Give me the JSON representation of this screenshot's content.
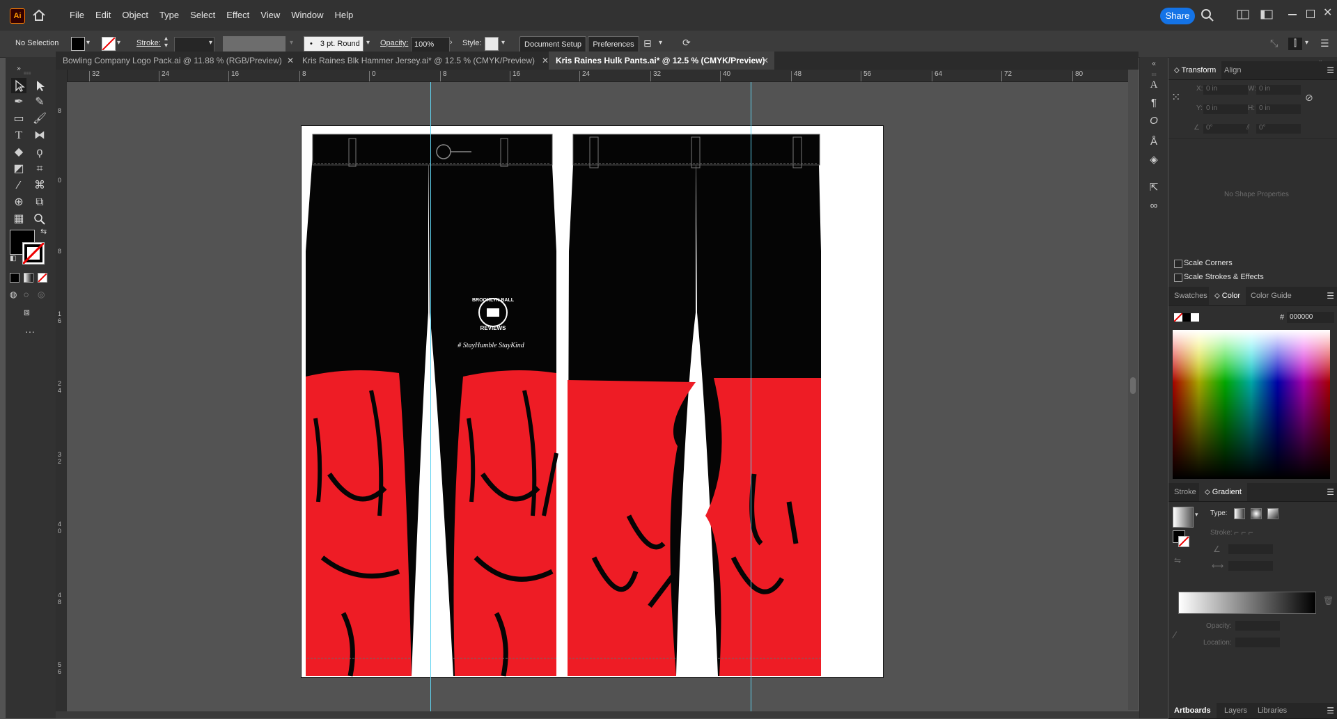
{
  "app": {
    "logo": "Ai",
    "share_label": "Share"
  },
  "menu": [
    "File",
    "Edit",
    "Object",
    "Type",
    "Select",
    "Effect",
    "View",
    "Window",
    "Help"
  ],
  "control_bar": {
    "selection": "No Selection",
    "stroke_label": "Stroke:",
    "brush": "3 pt. Round",
    "opacity_label": "Opacity:",
    "opacity_value": "100%",
    "style_label": "Style:",
    "document_setup": "Document Setup",
    "preferences": "Preferences"
  },
  "tabs": [
    {
      "label": "Bowling Company Logo Pack.ai @ 11.88 % (RGB/Preview)",
      "active": false
    },
    {
      "label": "Kris Raines Blk Hammer Jersey.ai* @ 12.5 % (CMYK/Preview)",
      "active": false
    },
    {
      "label": "Kris Raines Hulk Pants.ai* @ 12.5 % (CMYK/Preview)",
      "active": true
    }
  ],
  "ruler_h": [
    "32",
    "24",
    "16",
    "8",
    "0",
    "8",
    "16",
    "24",
    "32",
    "40",
    "48",
    "56",
    "64",
    "72",
    "80"
  ],
  "ruler_v": [
    "8",
    "0",
    "8",
    "1\n6",
    "2\n4",
    "3\n2",
    "4\n0",
    "4\n8",
    "5\n6"
  ],
  "artwork": {
    "colors": {
      "black": "#050505",
      "red": "#ee1c25",
      "white": "#ffffff"
    },
    "hashtag": "# StayHumble StayKind",
    "logo_text_top": "BROOKLYN BALL",
    "logo_text_bottom": "REVIEWS"
  },
  "panels": {
    "transform_tabs": [
      "Transform",
      "Align"
    ],
    "transform_fields": {
      "x_label": "X:",
      "x": "0 in",
      "y_label": "Y:",
      "y": "0 in",
      "w_label": "W:",
      "w": "0 in",
      "h_label": "H:",
      "h": "0 in",
      "angle": "0°",
      "shear": "0°"
    },
    "no_shape": "No Shape Properties",
    "scale_corners": "Scale Corners",
    "scale_strokes": "Scale Strokes & Effects",
    "color_tabs": [
      "Swatches",
      "Color",
      "Color Guide"
    ],
    "hex_label": "#",
    "hex_value": "000000",
    "gradient_tabs": [
      "Stroke",
      "Gradient"
    ],
    "gradient_type_label": "Type:",
    "gradient_stroke_label": "Stroke:",
    "gradient_opacity_label": "Opacity:",
    "gradient_location_label": "Location:",
    "bottom_tabs": [
      "Artboards",
      "Layers",
      "Libraries"
    ]
  }
}
